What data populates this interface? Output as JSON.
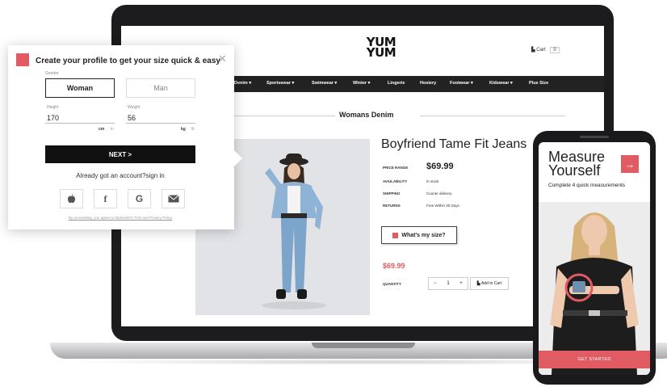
{
  "store": {
    "logo_line1": "YUM",
    "logo_line2": "YUM",
    "cart_label": "Cart",
    "cart_count": "0",
    "nav": [
      "Denim ▾",
      "Sportswear ▾",
      "Swimwear ▾",
      "Winter ▾",
      "Lingerie",
      "Hosiery",
      "Footwear ▾",
      "Kidswear ▾",
      "Plus Size"
    ],
    "section_title": "Womans Denim",
    "product_title": "Boyfriend Tame Fit Jeans",
    "specs": [
      {
        "label": "PRICE RANGE",
        "value": "$69.99"
      },
      {
        "label": "AVAILABILITY",
        "value": "In stock"
      },
      {
        "label": "SHIPPING",
        "value": "Courier delivery"
      },
      {
        "label": "RETURNS",
        "value": "Free Within 30 Days"
      }
    ],
    "whats_my_size": "What's my size?",
    "price": "$69.99",
    "quantity_label": "QUANTITY",
    "qty_minus": "−",
    "qty_value": "1",
    "qty_plus": "+",
    "add_to_cart": "Add to Cart"
  },
  "modal": {
    "title": "Create your profile to get your size quick & easy",
    "close": "✕",
    "gender_label": "Gender",
    "gender_options": [
      "Woman",
      "Man"
    ],
    "gender_selected": "Woman",
    "height_label": "Height",
    "height_value": "170",
    "height_unit": "cm",
    "height_alt_unit": "in",
    "weight_label": "Weight",
    "weight_value": "56",
    "weight_unit": "kg",
    "weight_alt_unit": "lb",
    "next_label": "NEXT >",
    "signin_text": "Already got an account?sign in",
    "social": [
      "apple-icon",
      "facebook-icon",
      "google-icon",
      "email-icon"
    ],
    "legal_text": "By proceeding, you agree to MySizeID's TOS and Privacy Policy"
  },
  "phone": {
    "title": "Measure Yourself",
    "subtitle": "Complete 4 quick measurements",
    "cta": "GET STARTED"
  },
  "colors": {
    "accent": "#e15b63",
    "dark": "#222222"
  }
}
